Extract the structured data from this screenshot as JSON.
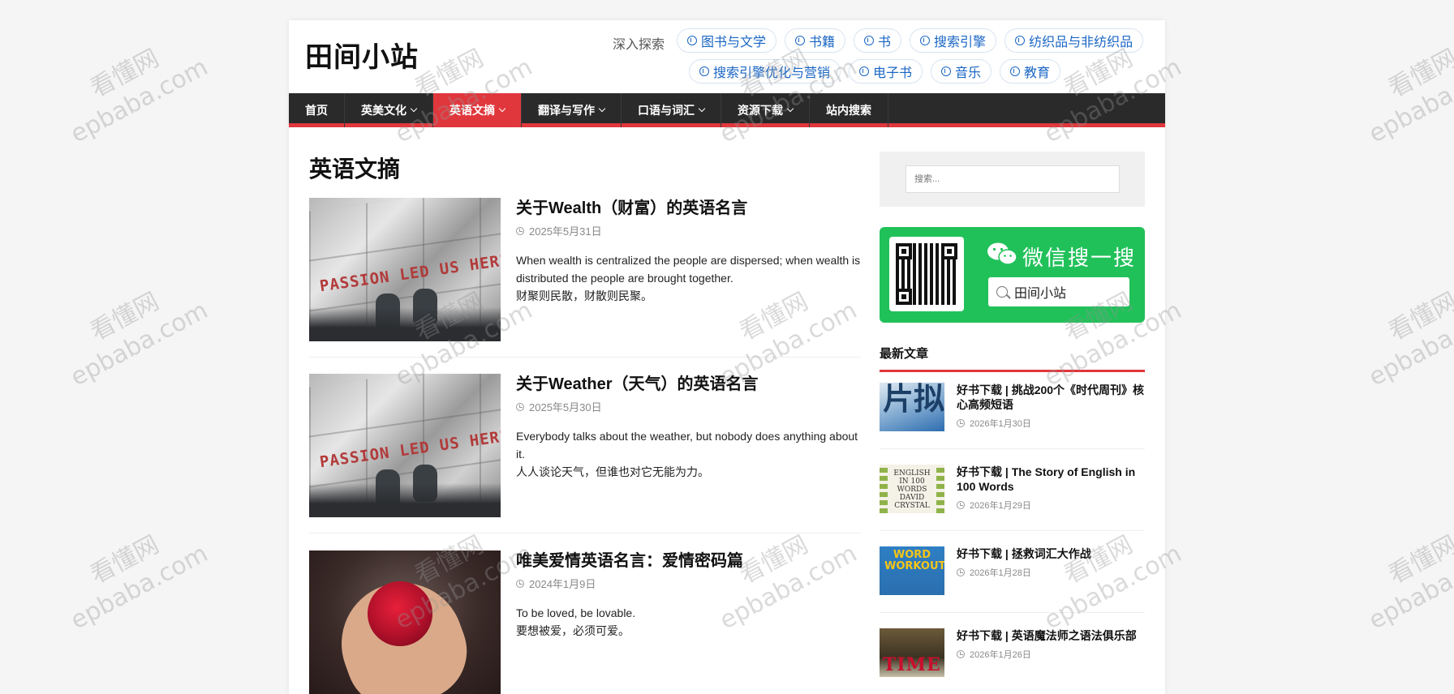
{
  "header": {
    "site_title": "田间小站",
    "explore_label": "深入探索",
    "tags_row1": [
      "图书与文学",
      "书籍",
      "书",
      "搜索引擎",
      "纺织品与非纺织品"
    ],
    "tags_row2": [
      "搜索引擎优化与营销",
      "电子书",
      "音乐",
      "教育"
    ]
  },
  "nav": {
    "items": [
      {
        "label": "首页",
        "dropdown": false,
        "active": false
      },
      {
        "label": "英美文化",
        "dropdown": true,
        "active": false
      },
      {
        "label": "英语文摘",
        "dropdown": true,
        "active": true
      },
      {
        "label": "翻译与写作",
        "dropdown": true,
        "active": false
      },
      {
        "label": "口语与词汇",
        "dropdown": true,
        "active": false
      },
      {
        "label": "资源下载",
        "dropdown": true,
        "active": false
      },
      {
        "label": "站内搜索",
        "dropdown": false,
        "active": false
      }
    ]
  },
  "main": {
    "page_title": "英语文摘",
    "posts": [
      {
        "title": "关于Wealth（财富）的英语名言",
        "date": "2025年5月31日",
        "excerpt_en": "When wealth is centralized the people are dispersed; when wealth is distributed the people are brought together.",
        "excerpt_zh": "财聚则民散，财散则民聚。",
        "image_text": "PASSION LED US HERE"
      },
      {
        "title": "关于Weather（天气）的英语名言",
        "date": "2025年5月30日",
        "excerpt_en": "Everybody talks about the weather, but nobody does anything about it.",
        "excerpt_zh": "人人谈论天气，但谁也对它无能为力。",
        "image_text": "PASSION LED US HERE"
      },
      {
        "title": "唯美爱情英语名言：爱情密码篇",
        "date": "2024年1月9日",
        "excerpt_en": "To be loved, be lovable.",
        "excerpt_zh": "要想被爱，必须可爱。"
      }
    ]
  },
  "sidebar": {
    "search_placeholder": "搜索...",
    "wechat": {
      "title": "微信搜一搜",
      "search_text": "田间小站"
    },
    "recent_title": "最新文章",
    "recent": [
      {
        "title": "好书下载 | 挑战200个《时代周刊》核心高频短语",
        "date": "2026年1月30日",
        "thumb_text": "片拟"
      },
      {
        "title": "好书下载 | The Story of English in 100 Words",
        "date": "2026年1月29日",
        "thumb_text": "ENGLISH IN 100 WORDS DAVID CRYSTAL"
      },
      {
        "title": "好书下载 | 拯救词汇大作战",
        "date": "2026年1月28日",
        "thumb_text": "WORD WORKOUT"
      },
      {
        "title": "好书下载 | 英语魔法师之语法俱乐部",
        "date": "2026年1月26日",
        "thumb_text": "TIME"
      }
    ]
  },
  "watermark": {
    "line1": "看懂网",
    "line2": "epbaba.com"
  },
  "colors": {
    "accent": "#e0373c",
    "nav_bg": "#2a2a2a",
    "tag_blue": "#1a66c4",
    "wechat_green": "#21c15a"
  }
}
